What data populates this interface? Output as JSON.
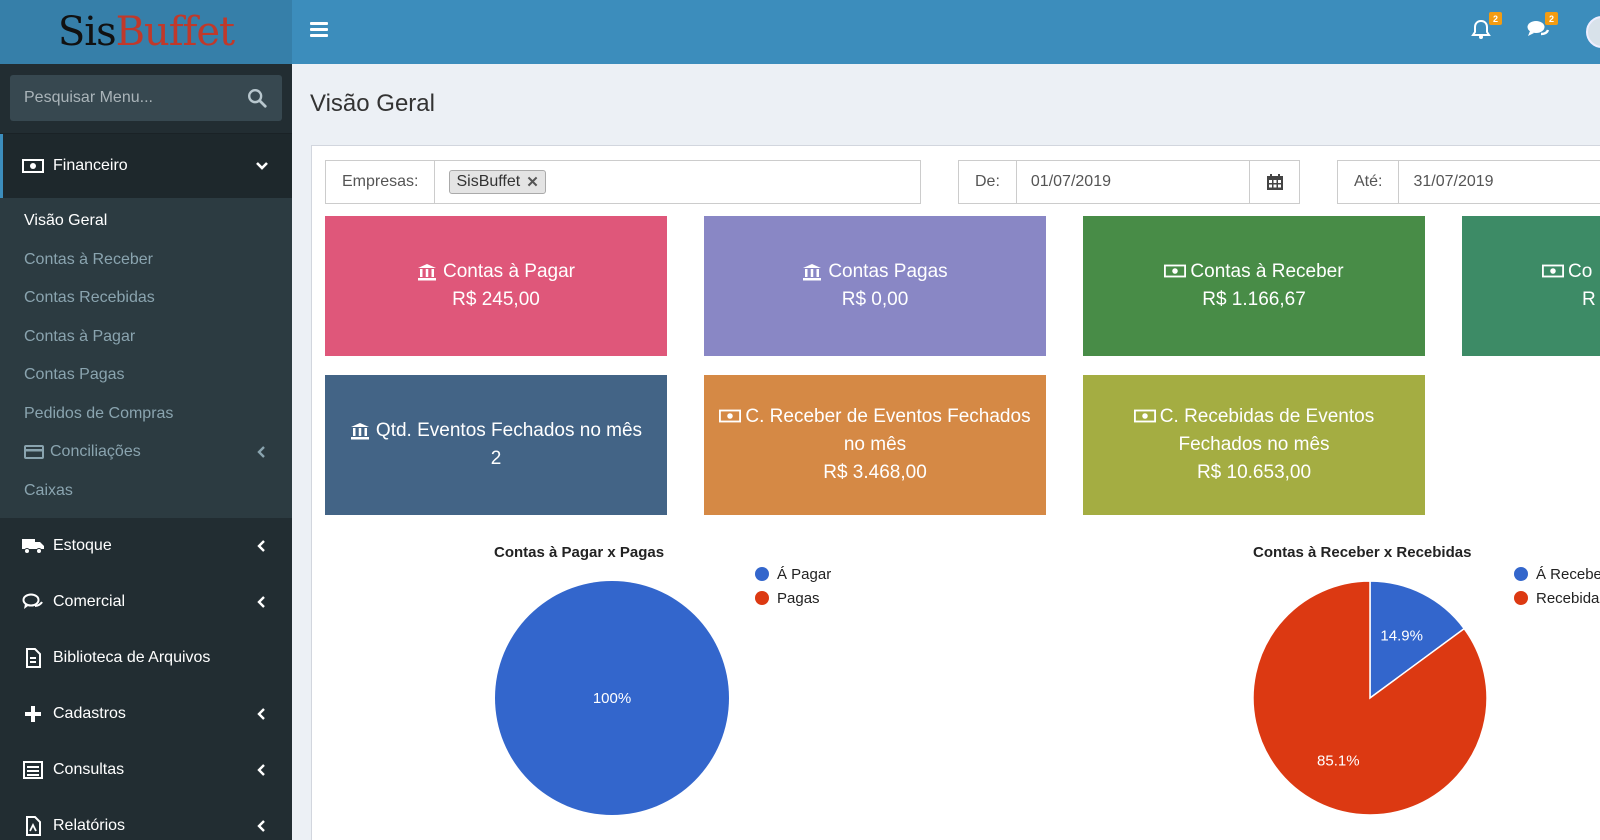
{
  "app": {
    "logo_text_a": "Sis",
    "logo_text_b": "Buffet",
    "accent": "#3c8dbc",
    "header_bg": "#3c8dbc",
    "sidebar_bg": "#222d32"
  },
  "sidebar": {
    "search_placeholder": "Pesquisar Menu...",
    "financeiro": {
      "label": "Financeiro",
      "items": [
        {
          "label": "Visão Geral"
        },
        {
          "label": "Contas à Receber"
        },
        {
          "label": "Contas Recebidas"
        },
        {
          "label": "Contas à Pagar"
        },
        {
          "label": "Contas Pagas"
        },
        {
          "label": "Pedidos de Compras"
        },
        {
          "label": "Conciliações"
        },
        {
          "label": "Caixas"
        }
      ]
    },
    "menu": [
      {
        "label": "Estoque",
        "icon": "truck-icon"
      },
      {
        "label": "Comercial",
        "icon": "comments-icon"
      },
      {
        "label": "Biblioteca de Arquivos",
        "icon": "file-icon"
      },
      {
        "label": "Cadastros",
        "icon": "plus-icon"
      },
      {
        "label": "Consultas",
        "icon": "list-icon"
      },
      {
        "label": "Relatórios",
        "icon": "report-icon"
      }
    ]
  },
  "header": {
    "notifications_count": "2",
    "messages_count": "2"
  },
  "main": {
    "title": "Visão Geral",
    "filters": {
      "empresas_label": "Empresas:",
      "empresa_tag": "SisBuffet",
      "de_label": "De:",
      "de_value": "01/07/2019",
      "ate_label": "Até:",
      "ate_value": "31/07/2019"
    },
    "cards": [
      {
        "title": "Contas à Pagar",
        "value": "R$ 245,00",
        "color": "#df577a",
        "icon": "bank-icon"
      },
      {
        "title": "Contas Pagas",
        "value": "R$ 0,00",
        "color": "#8987c5",
        "icon": "bank-icon"
      },
      {
        "title": "Contas à Receber",
        "value": "R$ 1.166,67",
        "color": "#488c47",
        "icon": "money-icon"
      },
      {
        "title": "Co",
        "value": "R",
        "color": "#3d8b66",
        "icon": "money-icon"
      },
      {
        "title": "Qtd. Eventos Fechados no mês",
        "value": "2",
        "color": "#436486",
        "icon": "bank-icon"
      },
      {
        "title_a": "C. Receber de Eventos Fechados",
        "title_b": "no mês",
        "value": "R$ 3.468,00",
        "color": "#d58945",
        "icon": "money-icon"
      },
      {
        "title_a": "C. Recebidas de Eventos",
        "title_b": "Fechados no mês",
        "value": "R$ 10.653,00",
        "color": "#a4ad42",
        "icon": "money-icon"
      }
    ]
  },
  "chart_data": [
    {
      "type": "pie",
      "title": "Contas à Pagar x Pagas",
      "categories": [
        "Á Pagar",
        "Pagas"
      ],
      "values": [
        100,
        0
      ],
      "labels": [
        "100%",
        ""
      ],
      "colors": [
        "#3366cc",
        "#dc3912"
      ],
      "legend": "right"
    },
    {
      "type": "pie",
      "title": "Contas à Receber x Recebidas",
      "categories": [
        "Á Receber",
        "Recebidas"
      ],
      "values": [
        14.9,
        85.1
      ],
      "labels": [
        "14.9%",
        "85.1%"
      ],
      "colors": [
        "#3366cc",
        "#dc3912"
      ],
      "legend": "right"
    }
  ]
}
